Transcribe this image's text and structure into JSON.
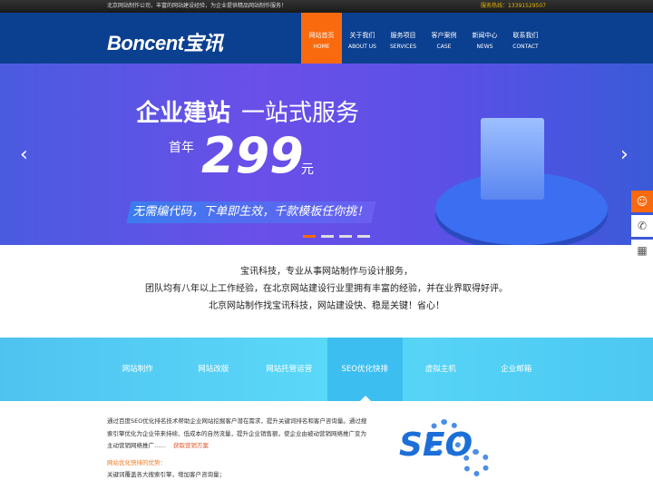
{
  "topbar": {
    "tagline": "北京网站制作公司，丰富的网站建设经验，为企业提供精品网站制作服务！",
    "hotline": "服务热线：13391529507"
  },
  "header": {
    "logo": "Boncent宝讯",
    "nav": [
      {
        "cn": "网站首页",
        "en": "HOME"
      },
      {
        "cn": "关于我们",
        "en": "ABOUT US"
      },
      {
        "cn": "服务项目",
        "en": "SERVICES"
      },
      {
        "cn": "客户案例",
        "en": "CASE"
      },
      {
        "cn": "新闻中心",
        "en": "NEWS"
      },
      {
        "cn": "联系我们",
        "en": "CONTACT"
      }
    ]
  },
  "banner": {
    "title1": "企业建站",
    "title2": "一站式服务",
    "pre": "首年",
    "price": "299",
    "unit": "元",
    "sub": "无需编代码，下单即生效，千款模板任你挑！",
    "prev": "‹",
    "next": "›",
    "active_slide": 1,
    "slides": 4
  },
  "side": {
    "icons": [
      "customer-service-icon",
      "phone-icon",
      "qrcode-icon"
    ]
  },
  "intro": {
    "lines": [
      "宝讯科技，专业从事网站制作与设计服务，",
      "团队均有八年以上工作经验，在北京网站建设行业里拥有丰富的经验，并在业界取得好评。",
      "北京网站制作找宝讯科技，网站建设快、稳是关键！省心！"
    ]
  },
  "tabs": [
    "网站制作",
    "网站改版",
    "网站托管运营",
    "SEO优化快排",
    "虚拟主机",
    "企业邮箱"
  ],
  "content": {
    "p1": "通过百度SEO优化排名技术帮助企业网站挖掘客户潜在需求，提升关键词排名和客户咨询量。通过搜索引擎优化为企业带来持续、低成本的自然流量，提升企业销售额，使企业由被动营销网络推广变为主动营销网络推广……",
    "link": "获取营销方案",
    "heading": "网站优化快排的优势：",
    "item1": "关键词覆盖各大搜索引擎，增加客户咨询量；",
    "image_text": "SEO"
  }
}
